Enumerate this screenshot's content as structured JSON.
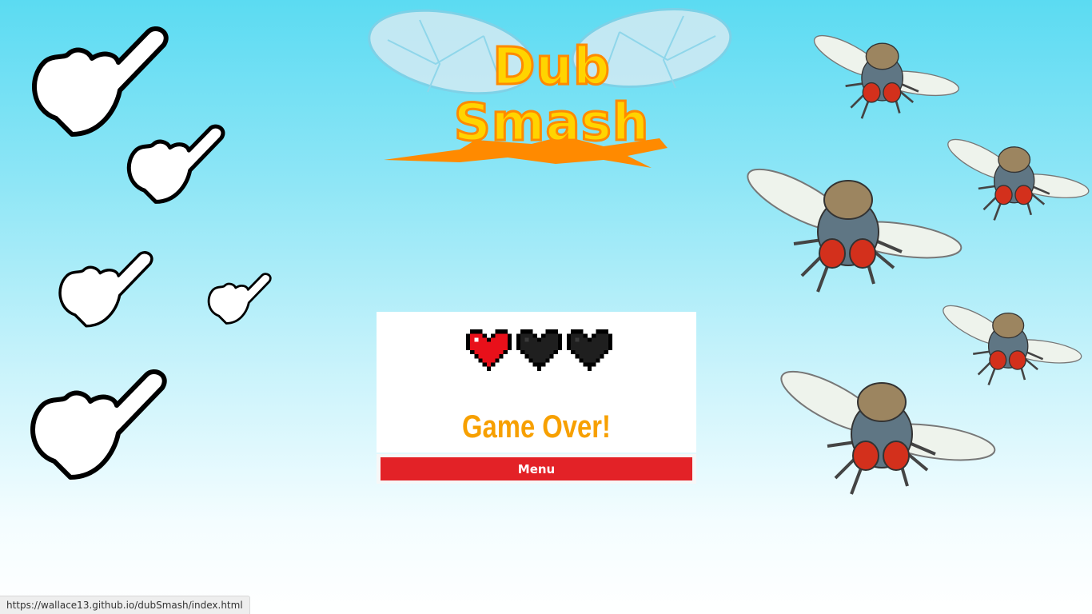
{
  "logo": {
    "line1": "Dub",
    "line2": "Smash"
  },
  "game": {
    "lives_total": 3,
    "lives_remaining": 1,
    "message": "Game Over!",
    "menu_label": "Menu"
  },
  "status_bar": {
    "url": "https://wallace13.github.io/dubSmash/index.html"
  },
  "icons": {
    "hand": "pointing-hand-icon",
    "fly": "fly-icon",
    "heart_full": "heart-full-icon",
    "heart_empty": "heart-empty-icon"
  },
  "colors": {
    "heart_full": "#e8101a",
    "heart_empty": "#1f1f1f",
    "game_over_text": "#f7a000",
    "menu_button": "#e32227",
    "logo_fill": "#ffd400",
    "logo_outline": "#ff8a00"
  }
}
